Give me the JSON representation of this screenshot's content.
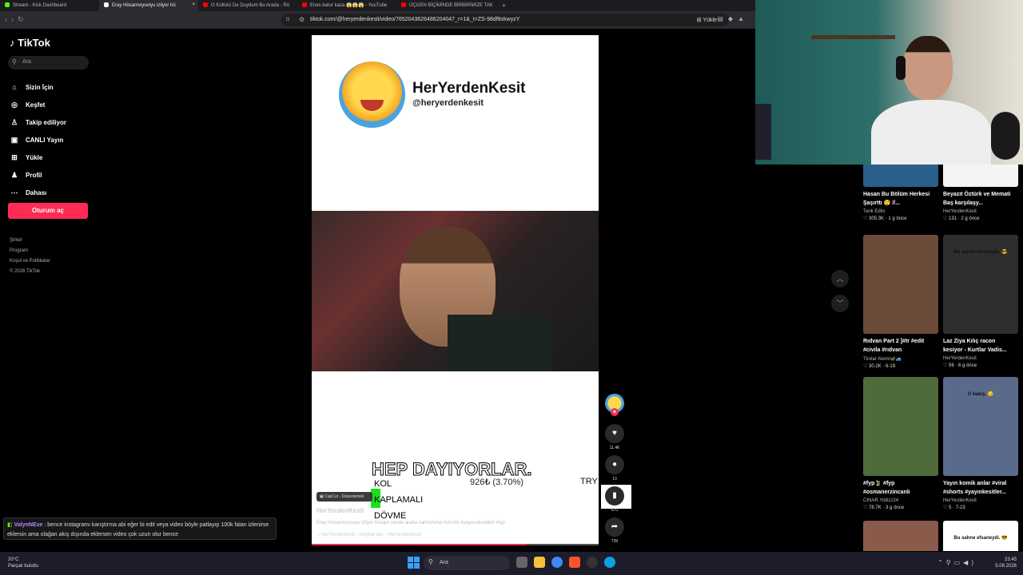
{
  "browser": {
    "tabs": [
      {
        "label": "Stream - Kick Dashboard",
        "color": "#53fc18"
      },
      {
        "label": "Eray Hüsamviyuviyu izliyor hü",
        "color": "#ffffff",
        "active": true
      },
      {
        "label": "O Kültürü De Duydum Bu Arada - Rü",
        "color": "#ff0000"
      },
      {
        "label": "Enes batur kaza 😱😱😱 - YouTube",
        "color": "#ff0000"
      },
      {
        "label": "ÜÇGEN BİÇİMİNDE BİRBİRİMİZE TAK",
        "color": "#ff0000"
      }
    ],
    "new_tab": "+",
    "url": "tiktok.com/@heryerdenkesit/video/7652043626486204047_r=1&_t=ZS-98df8xkwyzY",
    "upload_label": "Yükle"
  },
  "sidebar": {
    "logo": "TikTok",
    "search_placeholder": "Ara",
    "menu": [
      {
        "icon": "home-icon",
        "glyph": "⌂",
        "label": "Sizin İçin"
      },
      {
        "icon": "compass-icon",
        "glyph": "◎",
        "label": "Keşfet"
      },
      {
        "icon": "following-icon",
        "glyph": "♙",
        "label": "Takip ediliyor"
      },
      {
        "icon": "live-icon",
        "glyph": "▣",
        "label": "CANLI Yayın"
      },
      {
        "icon": "upload-icon",
        "glyph": "⊞",
        "label": "Yükle"
      },
      {
        "icon": "profile-icon",
        "glyph": "♟",
        "label": "Profil"
      },
      {
        "icon": "more-icon",
        "glyph": "⋯",
        "label": "Dahası"
      }
    ],
    "login_button": "Oturum aç",
    "footer": [
      "Şirket",
      "Program",
      "Koşul ve Politikalar",
      "© 2026 TikTok"
    ]
  },
  "video": {
    "account_name": "HerYerdenKesit",
    "account_handle": "@heryerdenkesit",
    "caption_big": "HEP DAYIYORLAR.",
    "overlay_lines": [
      "KOL",
      "KAPLAMALI",
      "DÖVME"
    ],
    "overlay_pct": "926₺ (3.70%)",
    "overlay_try": "TRY",
    "capcut_label": "CapCut - Düzenlemek",
    "author": "HerYerdenKesit",
    "description": "Eray Hüsamviyuviyu izliyor hüsam sende araba varmı#viral #shorts #yayıncıkesitleri #fyp",
    "sound": "HerYerdenKesit - original ses - HerYerdenKesit",
    "progress": 0.75,
    "actions": {
      "likes": "11.4K",
      "comments": "13",
      "saves": "670",
      "shares": "739"
    }
  },
  "recommended": [
    {
      "title": "Hasan Bu Bölüm Herkesi Şaşırttı 😲 //...",
      "author": "Tank Edits",
      "stats": "♡ 305.3K · 1 g önce",
      "color": "#2a5f8a",
      "overlay": ""
    },
    {
      "title": "Beyazıt Öztürk ve Memati Baş karşılaşy...",
      "author": "HerYerdenKesit",
      "stats": "♡ 131 · 2 g önce",
      "color": "#f4f4f4",
      "overlay": ""
    },
    {
      "title": "Rıdvan Part 2 ]#tr #edit #civila #rıdvan",
      "author": "Tirolar Alemi🦋🚙",
      "stats": "♡ 30.2K · 6-19",
      "color": "#6b4a3a",
      "overlay": ""
    },
    {
      "title": "Laz Ziya Kılıç racon kesiyor - Kurtlar Vadis...",
      "author": "HerYerdenKesit",
      "stats": "♡ 56 · 6 g önce",
      "color": "#2e2e2e",
      "overlay": "Bu sahne efsaneydi. 😎"
    },
    {
      "title": "#fyp🍃 #fyp #osmanerzincanlı",
      "author": "CINAR.Yildizz24",
      "stats": "♡ 78.7K · 3 g önce",
      "color": "#4f6a3b",
      "overlay": ""
    },
    {
      "title": "Yayın komik anlar #viral #shorts #yayınkesitler...",
      "author": "HerYerdenKesit",
      "stats": "♡ 5 · 7-23",
      "color": "#5a6a8a",
      "overlay": "O bakış. 😏"
    },
    {
      "title": "",
      "author": "",
      "stats": "",
      "color": "#8a5a4a",
      "overlay": ""
    },
    {
      "title": "",
      "author": "",
      "stats": "",
      "color": "#ffffff",
      "overlay": "Bu sahne efsaneydi. 😎"
    }
  ],
  "chat": {
    "user": "ValynNExe",
    "message": ": bence instagramı karıştırma abi eğer bi edit veya video böyle patlayıp 100k falan izlenirse eklersin ama olağan akış dışında eklersen video çok uzun olur bence"
  },
  "taskbar": {
    "temp": "20°C",
    "weather": "Parçalı bulutlu",
    "search": "Ara",
    "time": "23:45",
    "date": "5.08.2026"
  }
}
